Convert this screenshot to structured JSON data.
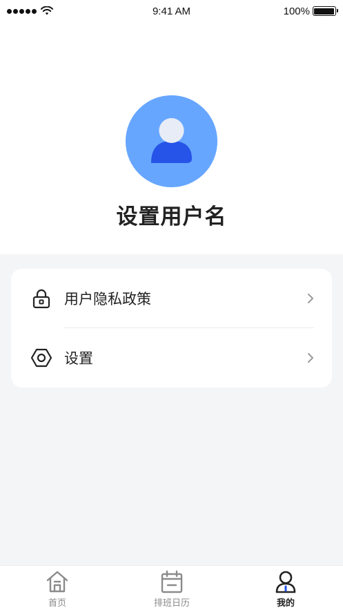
{
  "status_bar": {
    "time": "9:41 AM",
    "battery": "100%"
  },
  "profile": {
    "username": "设置用户名",
    "avatar_icon": "user-avatar-icon",
    "avatar_bg_color": "#66a6ff",
    "avatar_body_color": "#2653e8"
  },
  "menu": {
    "items": [
      {
        "label": "用户隐私政策",
        "icon": "lock-icon"
      },
      {
        "label": "设置",
        "icon": "hexagon-settings-icon"
      }
    ]
  },
  "tab_bar": {
    "tabs": [
      {
        "label": "首页",
        "icon": "home-icon",
        "active": false
      },
      {
        "label": "排班日历",
        "icon": "calendar-icon",
        "active": false
      },
      {
        "label": "我的",
        "icon": "profile-icon",
        "active": true
      }
    ],
    "accent_color": "#2653e8"
  }
}
